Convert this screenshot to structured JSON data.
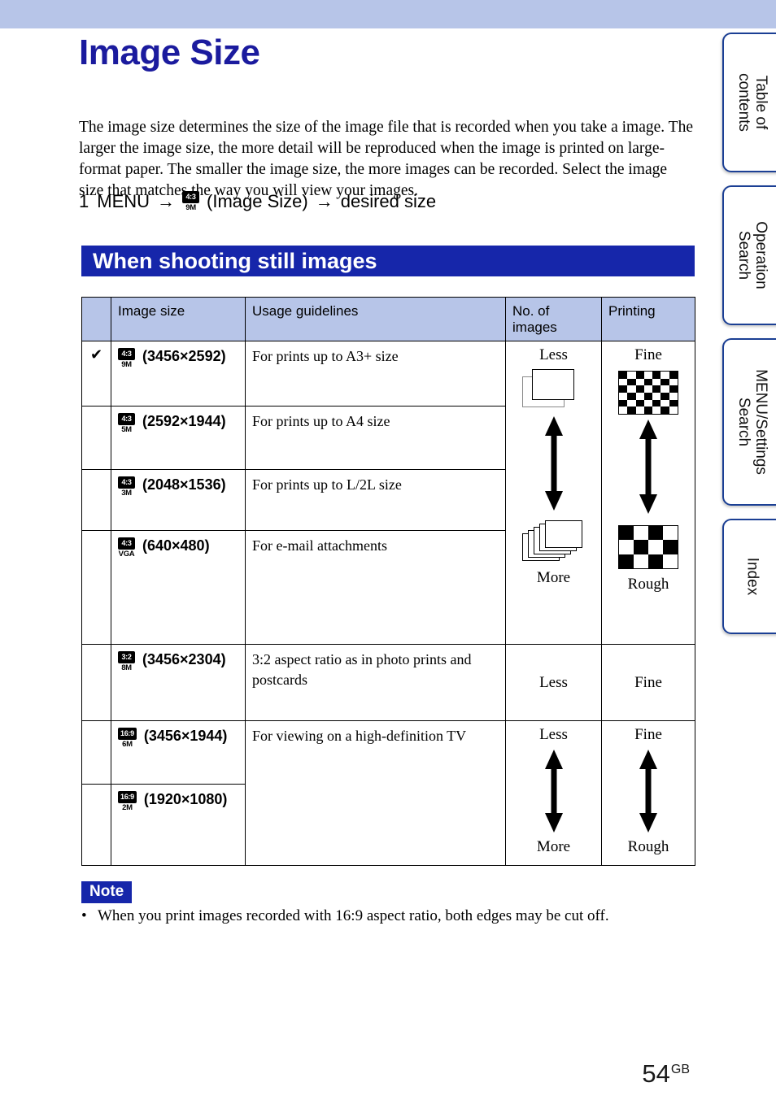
{
  "page": {
    "title": "Image Size",
    "number": "54",
    "number_suffix": "GB"
  },
  "intro": "The image size determines the size of the image file that is recorded when you take a image. The larger the image size, the more detail will be reproduced when the image is printed on large-format paper. The smaller the image size, the more images can be recorded. Select the image size that matches the way you will view your images.",
  "menu_step": {
    "number": "1",
    "menu_label": "MENU",
    "arrow": "→",
    "icon_ratio": "4:3",
    "icon_mp": "9M",
    "icon_caption": "(Image Size)",
    "result": "desired size"
  },
  "section": {
    "heading": "When shooting still images"
  },
  "table": {
    "headers": [
      "",
      "Image size",
      "Usage guidelines",
      "No. of images",
      "Printing"
    ],
    "check_glyph": "✔",
    "rows": [
      {
        "checked": true,
        "icon_ratio": "4:3",
        "icon_mp": "9M",
        "size": "(3456×2592)",
        "usage": "For prints up to A3+ size"
      },
      {
        "checked": false,
        "icon_ratio": "4:3",
        "icon_mp": "5M",
        "size": "(2592×1944)",
        "usage": "For prints up to A4 size"
      },
      {
        "checked": false,
        "icon_ratio": "4:3",
        "icon_mp": "3M",
        "size": "(2048×1536)",
        "usage": "For prints up to L/2L size"
      },
      {
        "checked": false,
        "icon_ratio": "4:3",
        "icon_mp": "VGA",
        "size": "(640×480)",
        "usage": "For e-mail attachments"
      },
      {
        "checked": false,
        "icon_ratio": "3:2",
        "icon_mp": "8M",
        "size": "(3456×2304)",
        "usage": "3:2 aspect ratio as in photo prints and postcards"
      },
      {
        "checked": false,
        "icon_ratio": "16:9",
        "icon_mp": "6M",
        "size": "(3456×1944)",
        "usage": "For viewing on a high-definition TV"
      },
      {
        "checked": false,
        "icon_ratio": "16:9",
        "icon_mp": "2M",
        "size": "(1920×1080)",
        "usage": ""
      }
    ],
    "scales": {
      "num_top": "Less",
      "num_bottom": "More",
      "print_top": "Fine",
      "print_bottom": "Rough"
    }
  },
  "note": {
    "badge": "Note",
    "bullet": "•",
    "items": [
      "When you print images recorded with 16:9 aspect ratio, both edges may be cut off."
    ]
  },
  "side_tabs": [
    {
      "line1": "Table of",
      "line2": "contents"
    },
    {
      "line1": "Operation",
      "line2": "Search"
    },
    {
      "line1": "MENU/Settings",
      "line2": "Search"
    },
    {
      "line1": "Index",
      "line2": ""
    }
  ],
  "colors": {
    "band": "#b7c5e8",
    "title": "#1b1b9e",
    "section_bar": "#1626aa",
    "table_header": "#b7c5e8",
    "tab_border": "#1b3f94"
  }
}
